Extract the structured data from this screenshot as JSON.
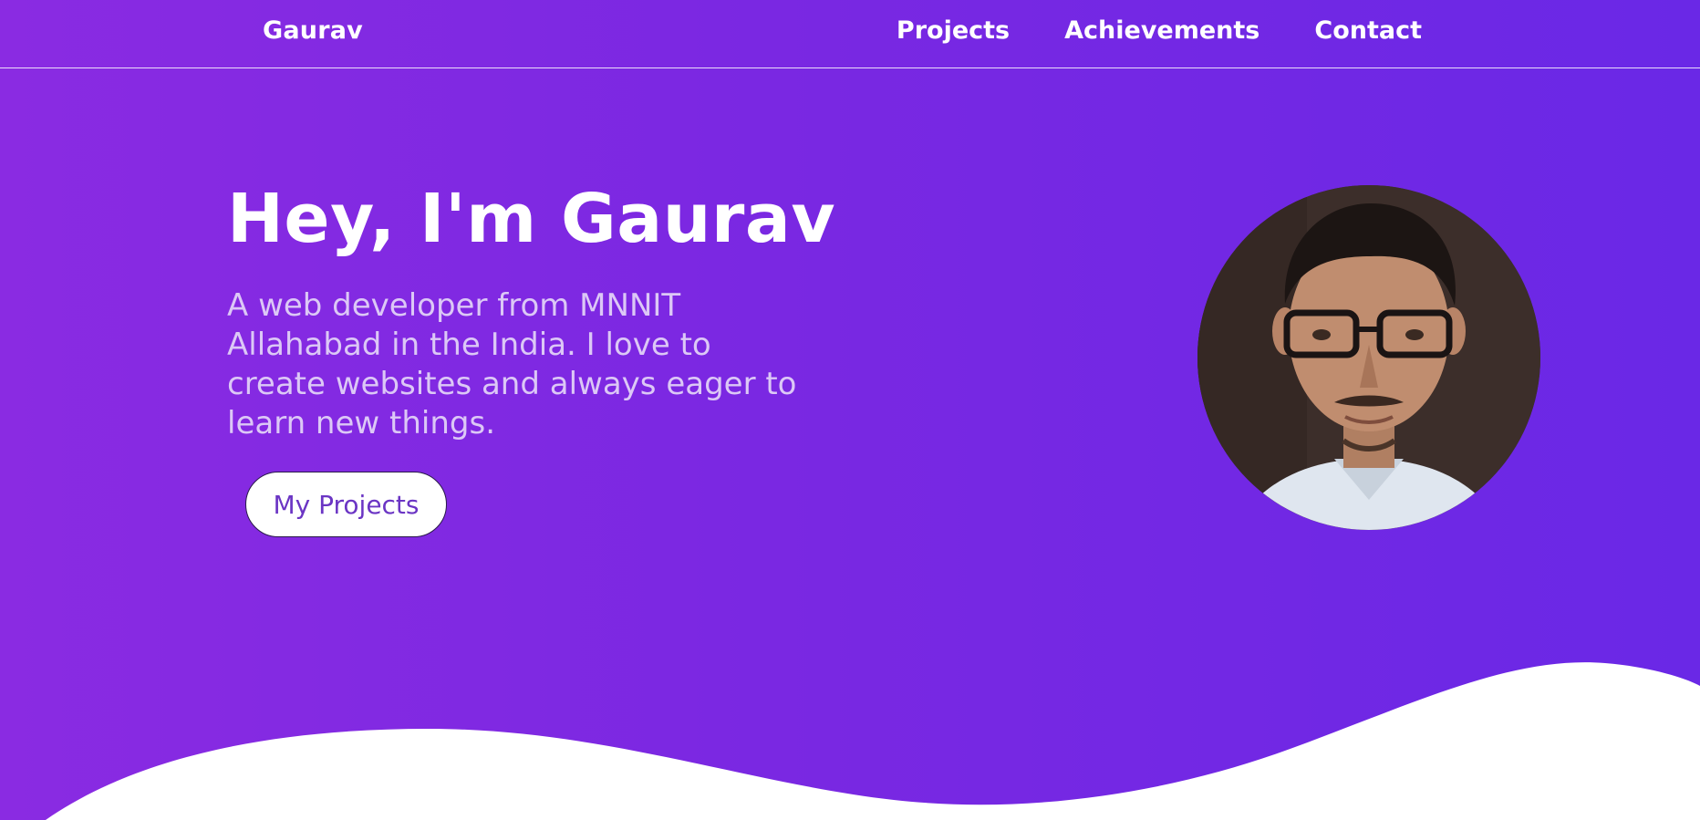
{
  "navbar": {
    "brand": "Gaurav",
    "links": [
      {
        "label": "Projects"
      },
      {
        "label": "Achievements"
      },
      {
        "label": "Contact"
      }
    ]
  },
  "hero": {
    "title": "Hey, I'm Gaurav",
    "subtitle": "A web developer from MNNIT Allahabad in the India. I love to create websites and always eager to learn new things.",
    "cta_label": "My Projects",
    "avatar_icon": "profile-photo",
    "gradient_start": "#8a2be2",
    "gradient_end": "#6a28e6",
    "subtitle_color": "#dcc8f6"
  }
}
